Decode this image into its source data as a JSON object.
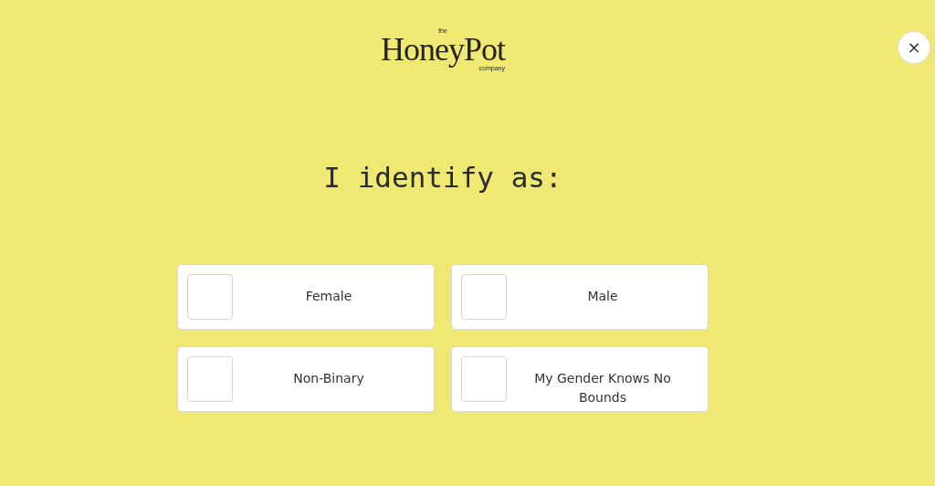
{
  "logo": {
    "small_top": "the",
    "name": "HoneyPot",
    "small_bottom": "company"
  },
  "close_button": "×",
  "question": "I identify as:",
  "options": [
    {
      "label": "Female",
      "checked": false
    },
    {
      "label": "Male",
      "checked": false
    },
    {
      "label": "Non-Binary",
      "checked": false
    },
    {
      "label": "My Gender Knows No Bounds",
      "checked": false
    }
  ]
}
